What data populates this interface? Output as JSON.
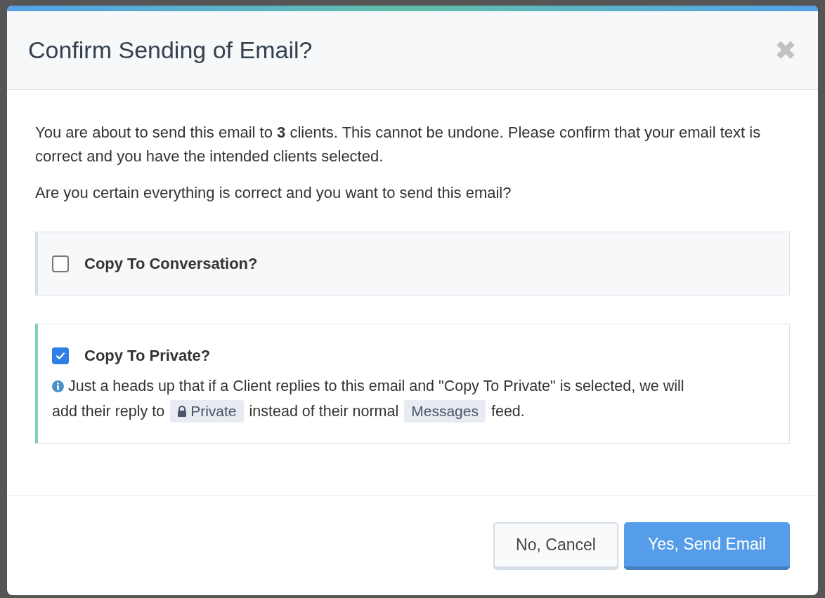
{
  "dialog": {
    "title": "Confirm Sending of Email?",
    "close_label": "✖",
    "message": "You are about to send this email to **3** clients. This cannot be undone. Please confirm that your email text is correct and you have the intended clients selected.",
    "question": "Are you certain everything is correct and you want to send this email?",
    "options": [
      {
        "label": "Copy To Conversation?",
        "checked": false
      },
      {
        "label": "Copy To Private?",
        "checked": true,
        "note": [
          [
            {
              "kind": "text",
              "text": "Just a heads up that if a Client replies to this email and \"Copy To Private\" is selected, we will"
            }
          ],
          [
            {
              "kind": "text",
              "text": "add their reply to"
            },
            {
              "kind": "badge",
              "text": "Private",
              "locked": true
            },
            {
              "kind": "text",
              "text": "instead of their normal"
            },
            {
              "kind": "badge",
              "text": "Messages",
              "locked": false
            },
            {
              "kind": "text",
              "text": "feed."
            }
          ]
        ]
      }
    ],
    "buttons": [
      {
        "label": "No, Cancel",
        "kind": "secondary"
      },
      {
        "label": "Yes, Send Email",
        "kind": "primary"
      }
    ]
  }
}
